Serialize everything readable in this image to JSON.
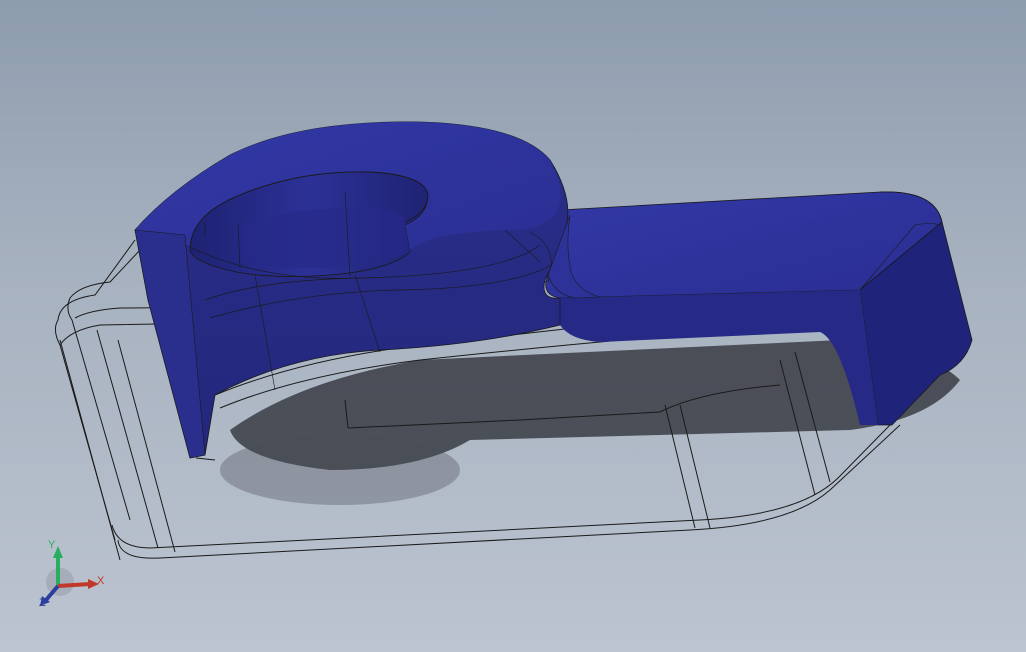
{
  "viewport": {
    "background_top": "#8d9cae",
    "background_bottom": "#bcc4d0"
  },
  "model": {
    "body_color": "#2b2f8e",
    "face_dark": "#1f2377",
    "face_light": "#3a3fa8",
    "wire_color": "#1a1a1a"
  },
  "triad": {
    "x_label": "X",
    "y_label": "Y",
    "z_label": "Z",
    "x_color": "#c0392b",
    "y_color": "#27ae60",
    "z_color": "#2c3e9e"
  }
}
